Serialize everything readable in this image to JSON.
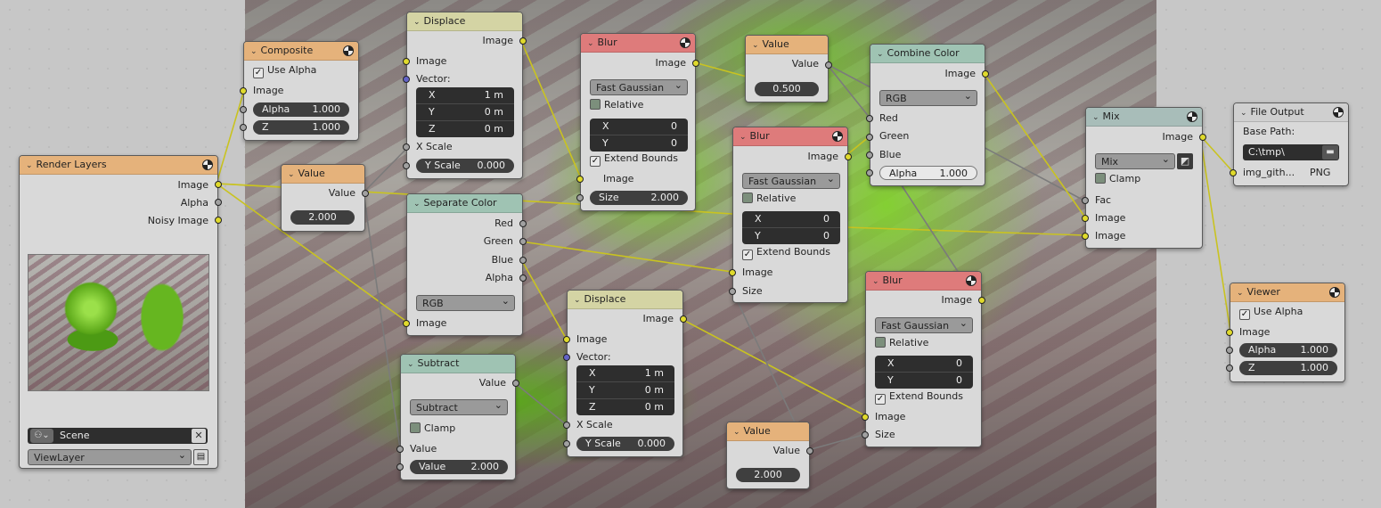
{
  "render_layers": {
    "title": "Render Layers",
    "outputs": [
      "Image",
      "Alpha",
      "Noisy Image"
    ],
    "scene": "Scene",
    "view_layer": "ViewLayer"
  },
  "composite": {
    "title": "Composite",
    "use_alpha": "Use Alpha",
    "image": "Image",
    "alpha_label": "Alpha",
    "alpha_value": "1.000",
    "z_label": "Z",
    "z_value": "1.000"
  },
  "value1": {
    "title": "Value",
    "out": "Value",
    "value": "2.000"
  },
  "displace1": {
    "title": "Displace",
    "out": "Image",
    "image": "Image",
    "vector": "Vector:",
    "x_label": "X",
    "x_value": "1 m",
    "y_label": "Y",
    "y_value": "0 m",
    "z_label": "Z",
    "z_value": "0 m",
    "xscale": "X Scale",
    "yscale_label": "Y Scale",
    "yscale_value": "0.000"
  },
  "separate": {
    "title": "Separate Color",
    "outputs": [
      "Red",
      "Green",
      "Blue",
      "Alpha"
    ],
    "mode": "RGB",
    "image": "Image"
  },
  "subtract": {
    "title": "Subtract",
    "out": "Value",
    "operation": "Subtract",
    "clamp": "Clamp",
    "value_in": "Value",
    "value_label": "Value",
    "value_value": "2.000"
  },
  "displace2": {
    "title": "Displace",
    "out": "Image",
    "image": "Image",
    "vector": "Vector:",
    "x_label": "X",
    "x_value": "1 m",
    "y_label": "Y",
    "y_value": "0 m",
    "z_label": "Z",
    "z_value": "0 m",
    "xscale": "X Scale",
    "yscale_label": "Y Scale",
    "yscale_value": "0.000"
  },
  "blur1": {
    "title": "Blur",
    "out": "Image",
    "filter": "Fast Gaussian",
    "relative": "Relative",
    "x_label": "X",
    "x_value": "0",
    "y_label": "Y",
    "y_value": "0",
    "extend": "Extend Bounds",
    "image": "Image",
    "size_label": "Size",
    "size_value": "2.000"
  },
  "value2": {
    "title": "Value",
    "out": "Value",
    "value": "0.500"
  },
  "blur2": {
    "title": "Blur",
    "out": "Image",
    "filter": "Fast Gaussian",
    "relative": "Relative",
    "x_label": "X",
    "x_value": "0",
    "y_label": "Y",
    "y_value": "0",
    "extend": "Extend Bounds",
    "image": "Image",
    "size": "Size"
  },
  "combine": {
    "title": "Combine Color",
    "out": "Image",
    "mode": "RGB",
    "red": "Red",
    "green": "Green",
    "blue": "Blue",
    "alpha_label": "Alpha",
    "alpha_value": "1.000"
  },
  "blur3": {
    "title": "Blur",
    "out": "Image",
    "filter": "Fast Gaussian",
    "relative": "Relative",
    "x_label": "X",
    "x_value": "0",
    "y_label": "Y",
    "y_value": "0",
    "extend": "Extend Bounds",
    "image": "Image",
    "size": "Size"
  },
  "value3": {
    "title": "Value",
    "out": "Value",
    "value": "2.000"
  },
  "mix": {
    "title": "Mix",
    "out": "Image",
    "mode": "Mix",
    "clamp": "Clamp",
    "fac": "Fac",
    "image1": "Image",
    "image2": "Image"
  },
  "file_output": {
    "title": "File Output",
    "base_path_label": "Base Path:",
    "base_path": "C:\\tmp\\",
    "slot_name": "img_gith...",
    "format": "PNG"
  },
  "viewer": {
    "title": "Viewer",
    "use_alpha": "Use Alpha",
    "image": "Image",
    "alpha_label": "Alpha",
    "alpha_value": "1.000",
    "z_label": "Z",
    "z_value": "1.000"
  },
  "colors": {
    "link_color": "#c9c320",
    "output_header": "#e5b27b",
    "converter_header": "#9fc3b3",
    "distort_header": "#d4d4a4",
    "filter_header": "#de7b7b"
  }
}
